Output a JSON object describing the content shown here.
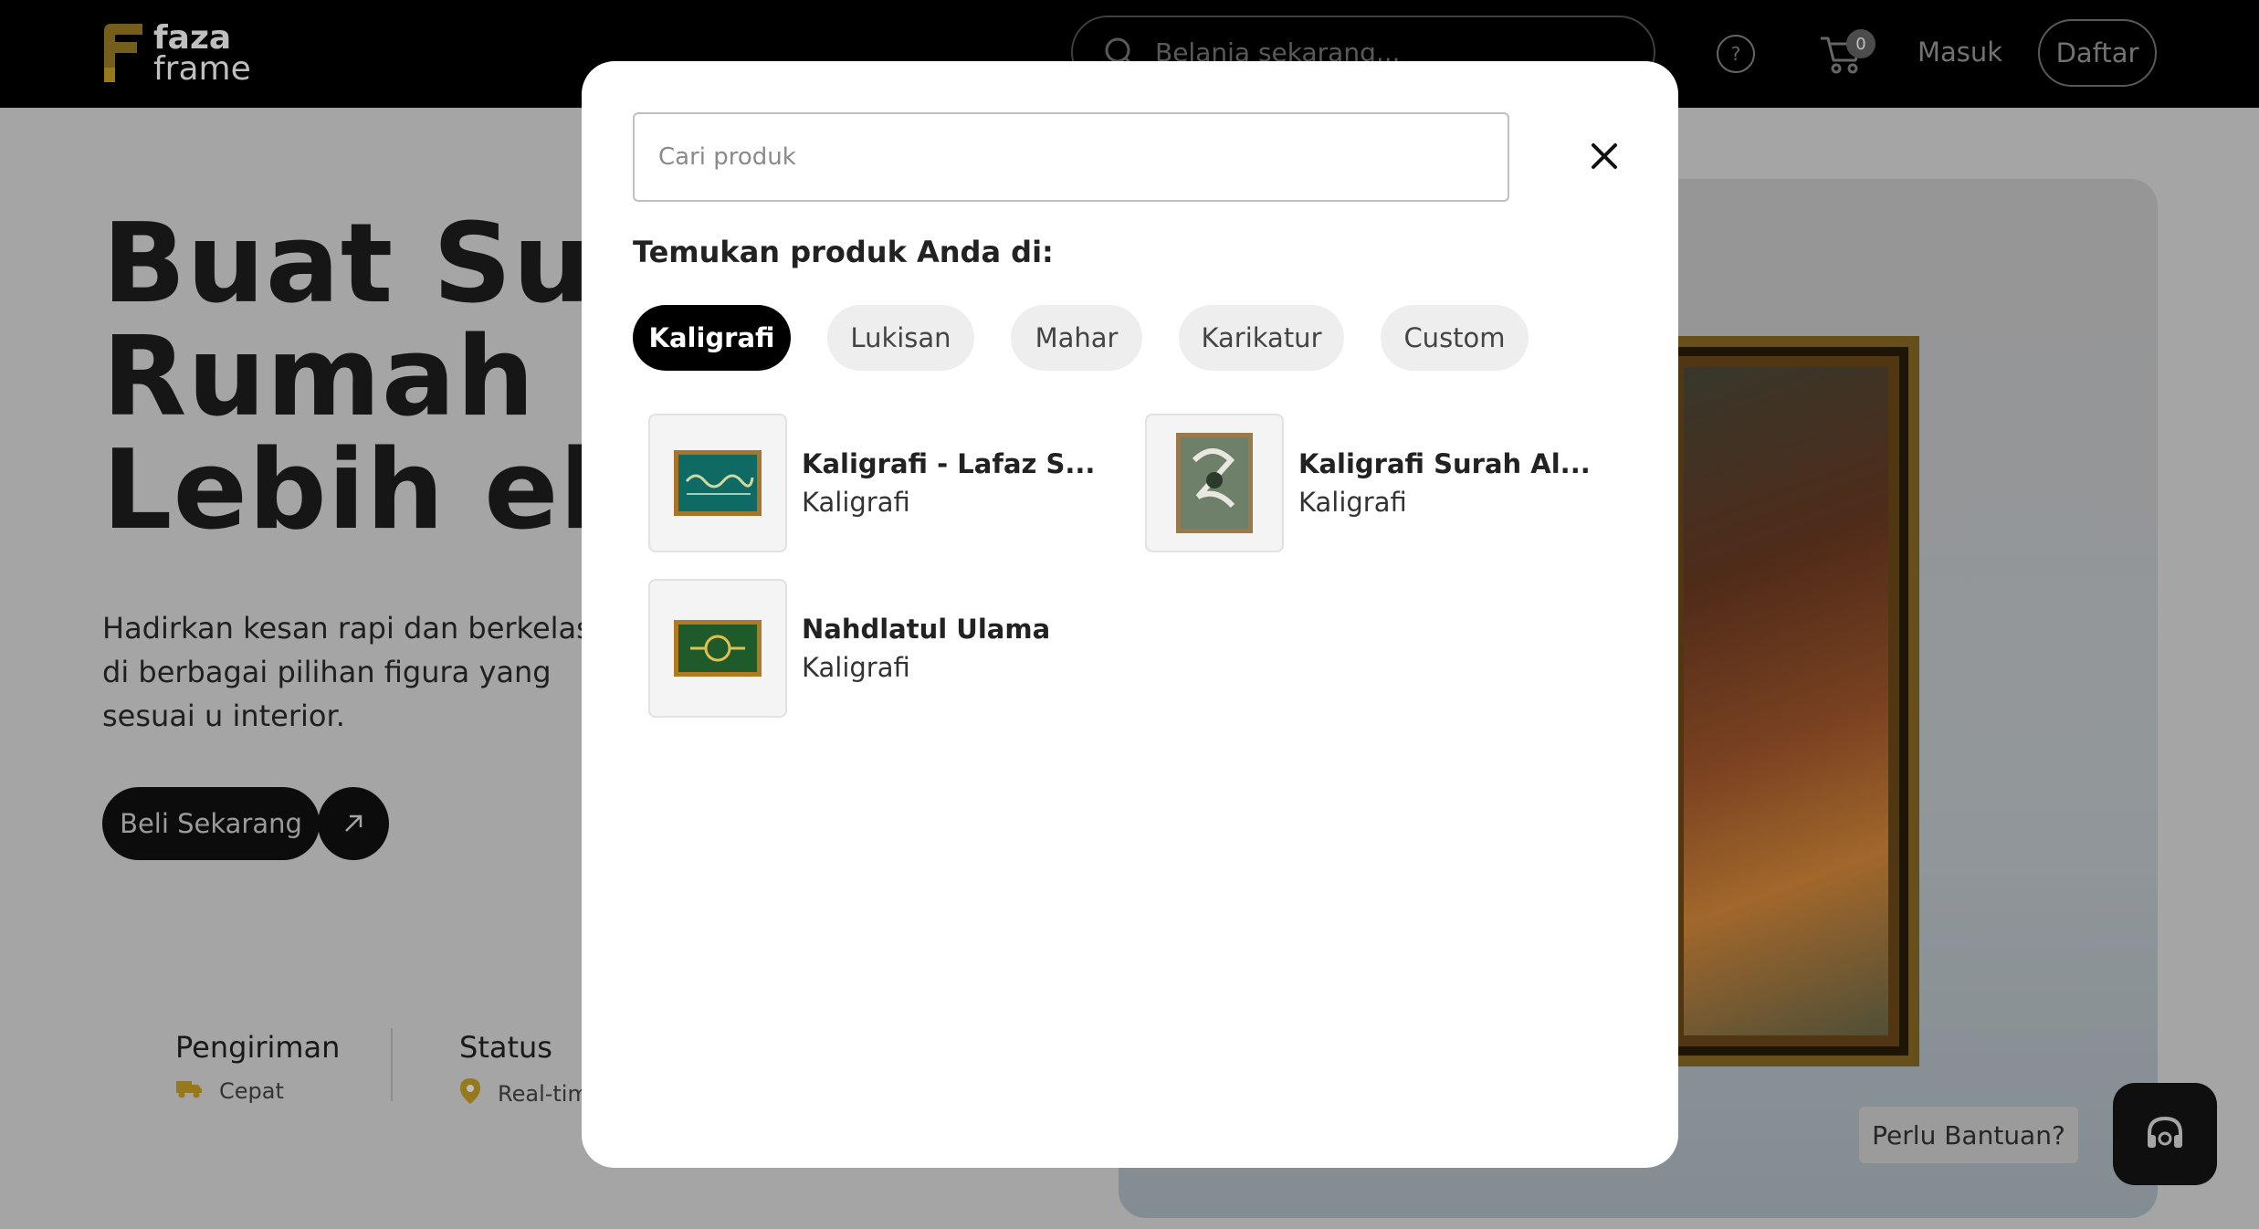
{
  "header": {
    "logo_line1": "faza",
    "logo_line2": "frame",
    "search_placeholder": "Belanja sekarang...",
    "help_glyph": "?",
    "cart_count": "0",
    "login_label": "Masuk",
    "register_label": "Daftar"
  },
  "hero": {
    "title_line1": "Buat Sudu",
    "title_line2": "Rumah ",
    "title_line3": "Lebih eleg",
    "description": "Hadirkan kesan rapi dan berkelas di berbagai pilihan figura yang sesuai u interior.",
    "cta_label": "Beli Sekarang",
    "features": [
      {
        "title": "Pengiriman",
        "subtitle": "Cepat",
        "icon": "truck-icon"
      },
      {
        "title": "Status",
        "subtitle": "Real-tim",
        "icon": "location-pin-icon"
      }
    ],
    "help_bubble": "Perlu Bantuan?"
  },
  "modal": {
    "search_placeholder": "Cari produk",
    "find_label": "Temukan produk Anda di:",
    "categories": [
      {
        "label": "Kaligrafi",
        "active": true
      },
      {
        "label": "Lukisan",
        "active": false
      },
      {
        "label": "Mahar",
        "active": false
      },
      {
        "label": "Karikatur",
        "active": false
      },
      {
        "label": "Custom",
        "active": false
      }
    ],
    "products": [
      {
        "name": "Kaligrafi - Lafaz S...",
        "category": "Kaligrafi"
      },
      {
        "name": "Kaligrafi Surah Al...",
        "category": "Kaligrafi"
      },
      {
        "name": "Nahdlatul Ulama",
        "category": "Kaligrafi"
      }
    ]
  },
  "colors": {
    "header_bg": "#000000",
    "brand_gold": "#c9a227",
    "chip_active_bg": "#000000",
    "chip_bg": "#eeeeee"
  }
}
